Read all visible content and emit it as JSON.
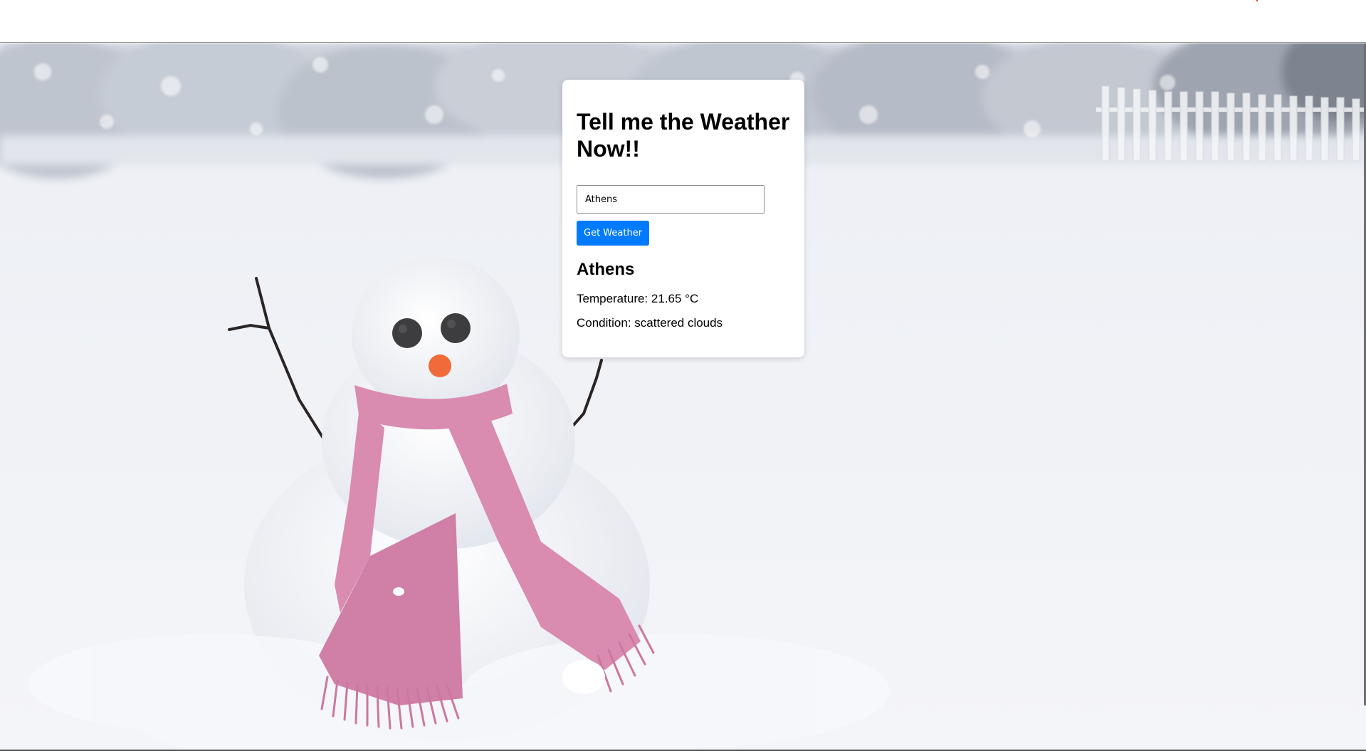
{
  "app": {
    "title": "Tell me the Weather Now!!"
  },
  "search": {
    "value": "Athens",
    "button_label": "Get Weather"
  },
  "result": {
    "city": "Athens",
    "temperature_label": "Temperature:",
    "temperature_value": "21.65 °C",
    "condition_label": "Condition:",
    "condition_value": "scattered clouds"
  },
  "colors": {
    "accent": "#007bff",
    "card_background": "#ffffff",
    "scarf": "#d98bb0",
    "carrot_nose": "#f06a3a"
  },
  "background": {
    "icon": "snowman-photo"
  }
}
